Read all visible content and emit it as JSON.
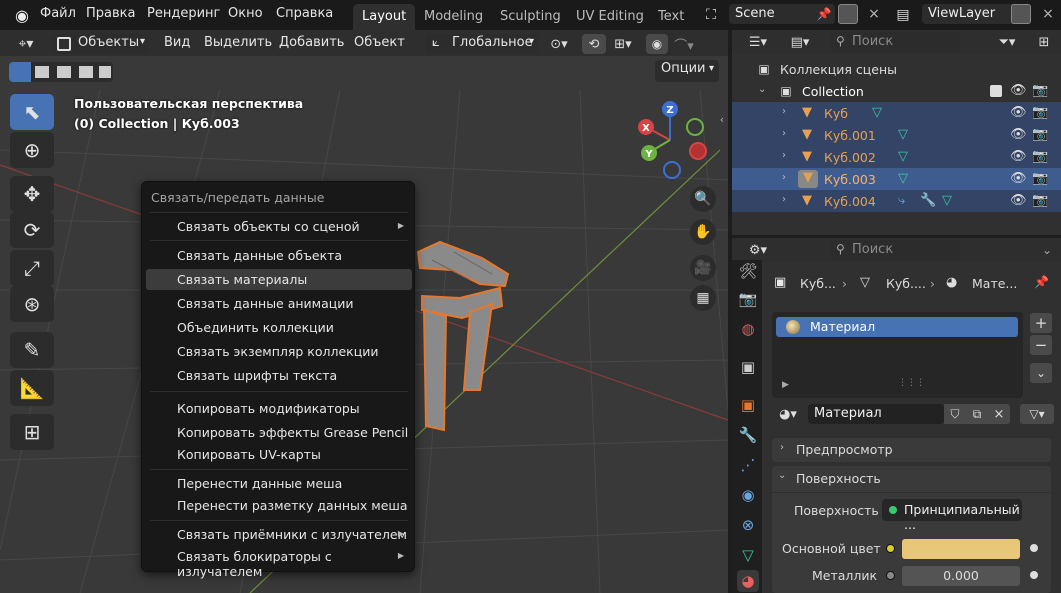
{
  "menu": {
    "file": "Файл",
    "edit": "Правка",
    "render": "Рендеринг",
    "window": "Окно",
    "help": "Справка"
  },
  "workspaces": [
    {
      "label": "Layout",
      "active": true
    },
    {
      "label": "Modeling",
      "active": false
    },
    {
      "label": "Sculpting",
      "active": false
    },
    {
      "label": "UV Editing",
      "active": false
    },
    {
      "label": "Text",
      "active": false
    }
  ],
  "scene": {
    "name": "Scene"
  },
  "view_layer": {
    "name": "ViewLayer"
  },
  "viewport_header": {
    "mode": "Объекты",
    "view": "Вид",
    "select": "Выделить",
    "add": "Добавить",
    "object": "Объект",
    "transform": "Глобальное",
    "options": "Опции"
  },
  "overlay": {
    "perspective": "Пользовательская перспектива",
    "collection_info": "(0) Collection | Куб.003"
  },
  "gizmo": {
    "z": "Z",
    "x": "X",
    "y": "Y"
  },
  "context_menu": {
    "title": "Связать/передать данные",
    "items": [
      {
        "label": "Связать объекты со сценой",
        "submenu": true
      },
      {
        "label": "Связать данные объекта",
        "submenu": false
      },
      {
        "label": "Связать материалы",
        "submenu": false,
        "highlighted": true
      },
      {
        "label": "Связать данные анимации",
        "submenu": false
      },
      {
        "label": "Объединить коллекции",
        "submenu": false
      },
      {
        "label": "Связать экземпляр коллекции",
        "submenu": false
      },
      {
        "label": "Связать шрифты текста",
        "submenu": false
      },
      {
        "label": "Копировать модификаторы",
        "submenu": false
      },
      {
        "label": "Копировать эффекты Grease Pencil",
        "submenu": false
      },
      {
        "label": "Копировать UV-карты",
        "submenu": false
      },
      {
        "label": "Перенести данные меша",
        "submenu": false
      },
      {
        "label": "Перенести разметку данных меша",
        "submenu": false
      },
      {
        "label": "Связать приёмники с излучателем",
        "submenu": true
      },
      {
        "label": "Связать блокираторы с излучателем",
        "submenu": true
      }
    ]
  },
  "outliner": {
    "search_placeholder": "Поиск",
    "scene_collection": "Коллекция сцены",
    "collection": "Collection",
    "objects": [
      {
        "name": "Куб",
        "state": "selected"
      },
      {
        "name": "Куб.001",
        "state": "selected"
      },
      {
        "name": "Куб.002",
        "state": "selected"
      },
      {
        "name": "Куб.003",
        "state": "active"
      },
      {
        "name": "Куб.004",
        "state": "selected"
      }
    ]
  },
  "properties": {
    "search_placeholder": "Поиск",
    "breadcrumb": [
      "Куб...",
      "Куб....",
      "Мате..."
    ],
    "material_slot": "Материал",
    "material_name": "Материал",
    "preview": "Предпросмотр",
    "surface_section": "Поверхность",
    "surface_label": "Поверхность",
    "surface_value": "Принципиальный ...",
    "base_color_label": "Основной цвет",
    "base_color": "#e8c878",
    "metallic_label": "Металлик",
    "metallic_value": "0.000"
  },
  "colors": {
    "accent": "#4772b3",
    "selected_object": "#e8772c",
    "object_icon": "#e8a050",
    "mesh_data": "#38c8a0"
  }
}
